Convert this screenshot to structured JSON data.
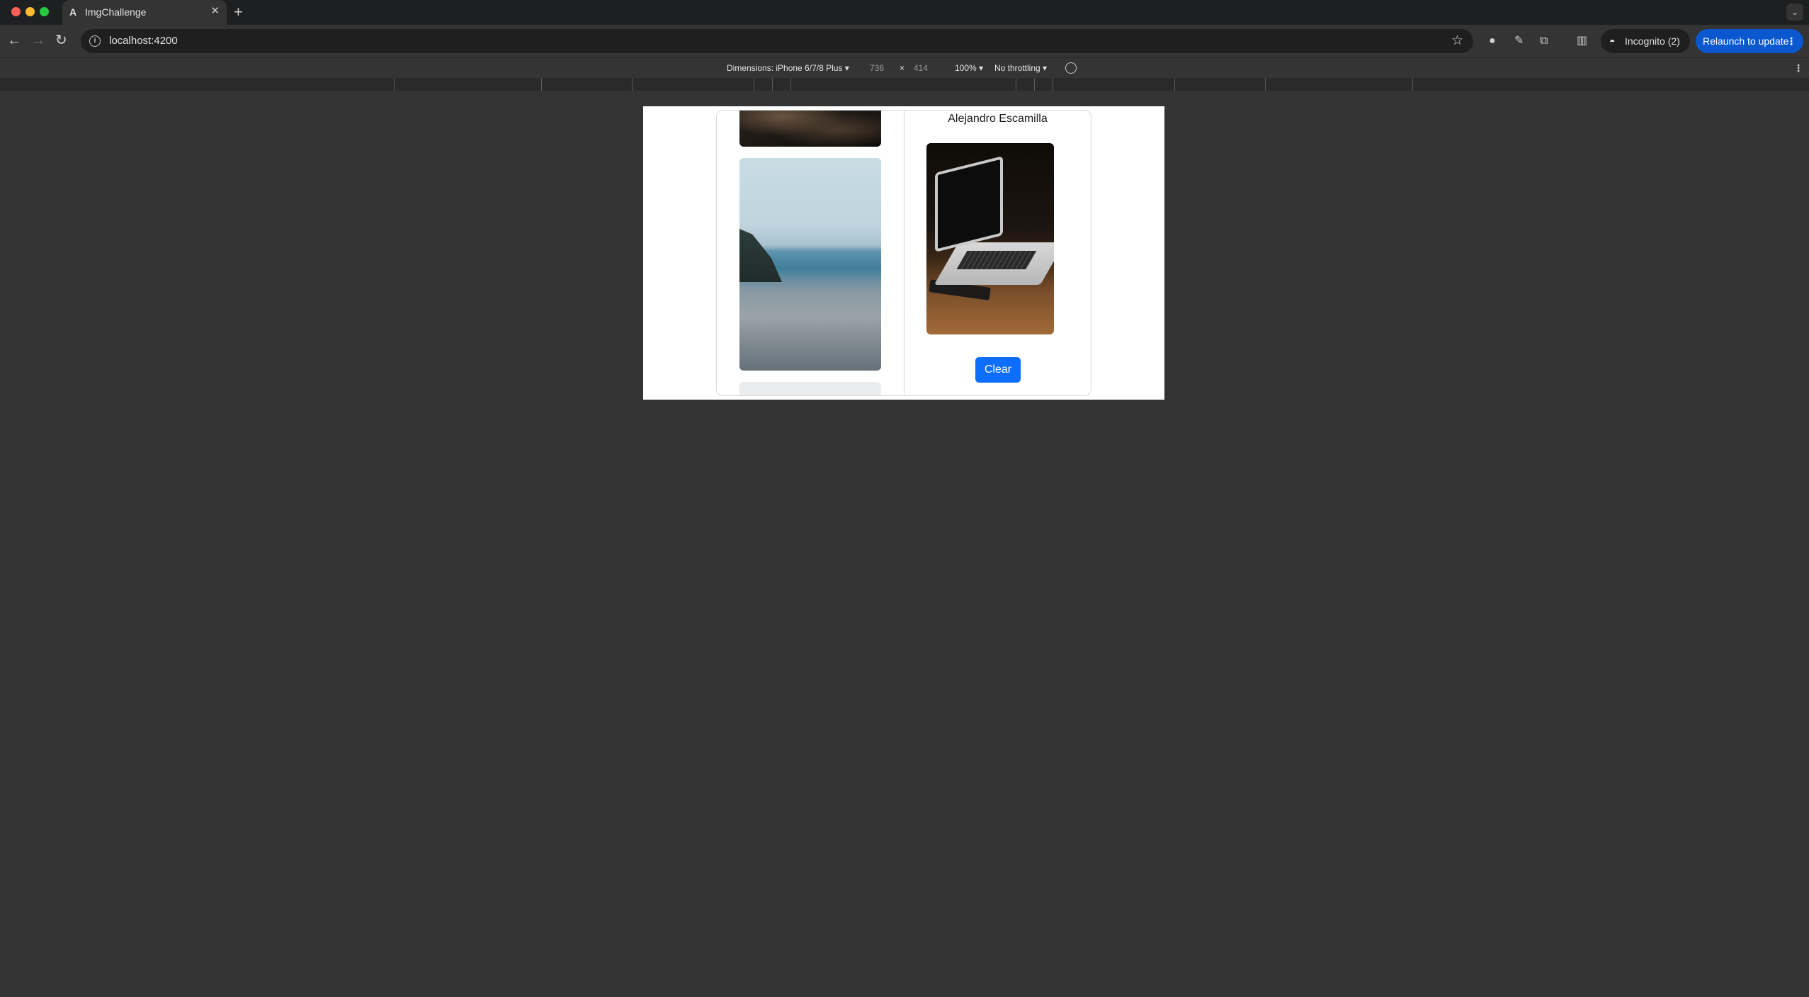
{
  "browser": {
    "tab": {
      "title": "ImgChallenge",
      "favicon": "A"
    },
    "url": "localhost:4200",
    "incognito_label": "Incognito (2)",
    "relaunch_label": "Relaunch to update"
  },
  "devtools": {
    "dimensions_label": "Dimensions: iPhone 6/7/8 Plus",
    "width": "736",
    "separator": "×",
    "height": "414",
    "zoom": "100%",
    "throttling": "No throttling"
  },
  "app": {
    "author": "Alejandro Escamilla",
    "clear_label": "Clear"
  },
  "icons": [
    "back-icon",
    "forward-icon",
    "reload-icon",
    "info-icon",
    "star-icon",
    "extension-icon",
    "puzzle-icon",
    "sidepanel-icon",
    "incognito-icon",
    "more-icon",
    "rotate-icon"
  ]
}
